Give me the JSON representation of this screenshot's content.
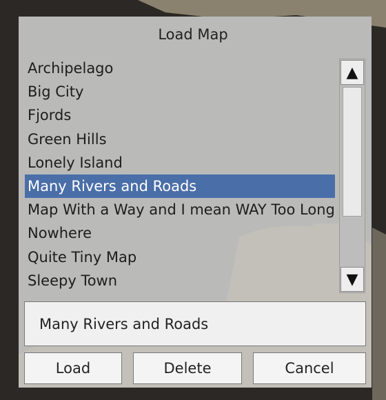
{
  "dialog": {
    "title": "Load Map"
  },
  "map_list": {
    "items": [
      {
        "label": "Archipelago"
      },
      {
        "label": "Big City"
      },
      {
        "label": "Fjords"
      },
      {
        "label": "Green Hills"
      },
      {
        "label": "Lonely Island"
      },
      {
        "label": "Many Rivers and Roads",
        "selected": true
      },
      {
        "label": "Map With a Way and I mean WAY Too Long Name"
      },
      {
        "label": "Nowhere"
      },
      {
        "label": "Quite Tiny Map"
      },
      {
        "label": "Sleepy Town"
      }
    ],
    "selected_color": "#4a6ea8"
  },
  "scrollbar": {
    "up_icon": "triangle-up-icon",
    "down_icon": "triangle-down-icon"
  },
  "name_field": {
    "value": "Many Rivers and Roads"
  },
  "buttons": {
    "load_label": "Load",
    "delete_label": "Delete",
    "cancel_label": "Cancel"
  }
}
